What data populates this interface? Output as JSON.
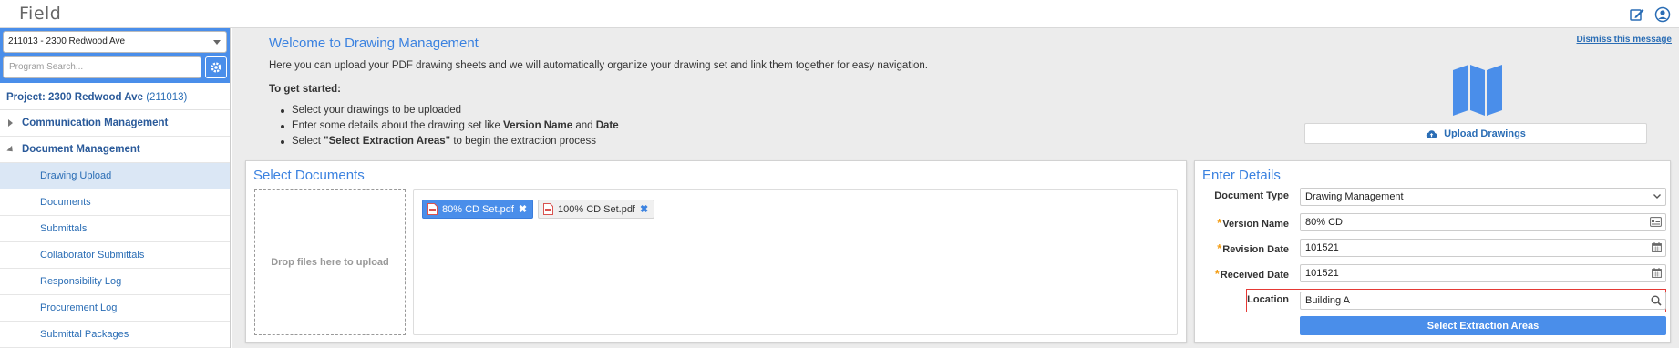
{
  "app": {
    "title": "Field"
  },
  "sidebar": {
    "project_select": "211013 - 2300 Redwood Ave",
    "search_placeholder": "Program Search...",
    "project_label": "Project: 2300 Redwood Ave",
    "project_code": "(211013)",
    "sections": [
      {
        "label": "Communication Management",
        "expanded": false
      },
      {
        "label": "Document Management",
        "expanded": true
      }
    ],
    "items": [
      {
        "label": "Drawing Upload",
        "active": true
      },
      {
        "label": "Documents"
      },
      {
        "label": "Submittals"
      },
      {
        "label": "Collaborator Submittals"
      },
      {
        "label": "Responsibility Log"
      },
      {
        "label": "Procurement Log"
      },
      {
        "label": "Submittal Packages"
      }
    ]
  },
  "welcome": {
    "title": "Welcome to Drawing Management",
    "dismiss": "Dismiss this message",
    "intro": "Here you can upload your PDF drawing sheets and we will automatically organize your drawing set and link them together for easy navigation.",
    "started": "To get started:",
    "step1": "Select your drawings to be uploaded",
    "step2_pre": "Enter some details about the drawing set like ",
    "step2_b1": "Version Name",
    "step2_mid": " and ",
    "step2_b2": "Date",
    "step3_pre": "Select ",
    "step3_b": "\"Select Extraction Areas\"",
    "step3_post": " to begin the extraction process",
    "upload_button": "Upload Drawings"
  },
  "select_documents": {
    "title": "Select Documents",
    "dropzone": "Drop files here to upload",
    "files": [
      {
        "name": "80% CD Set.pdf",
        "selected": true
      },
      {
        "name": "100% CD Set.pdf",
        "selected": false
      }
    ],
    "remove_glyph": "✖"
  },
  "enter_details": {
    "title": "Enter Details",
    "fields": {
      "document_type": {
        "label": "Document Type",
        "value": "Drawing Management"
      },
      "version_name": {
        "label": "Version Name",
        "value": "80% CD"
      },
      "revision_date": {
        "label": "Revision Date",
        "value": "101521"
      },
      "received_date": {
        "label": "Received Date",
        "value": "101521"
      },
      "location": {
        "label": "Location",
        "value": "Building A"
      }
    },
    "required_mark": "*",
    "extract_button": "Select Extraction Areas"
  },
  "colors": {
    "accent": "#4a8eea",
    "link": "#2a6db5",
    "highlight": "#e53935",
    "required": "#f39c12"
  },
  "icons": [
    "edit-icon",
    "user-icon",
    "gear-icon",
    "map-icon",
    "cloud-upload-icon",
    "pdf-icon",
    "calendar-icon",
    "id-card-icon",
    "search-icon",
    "chevron-down-icon"
  ]
}
